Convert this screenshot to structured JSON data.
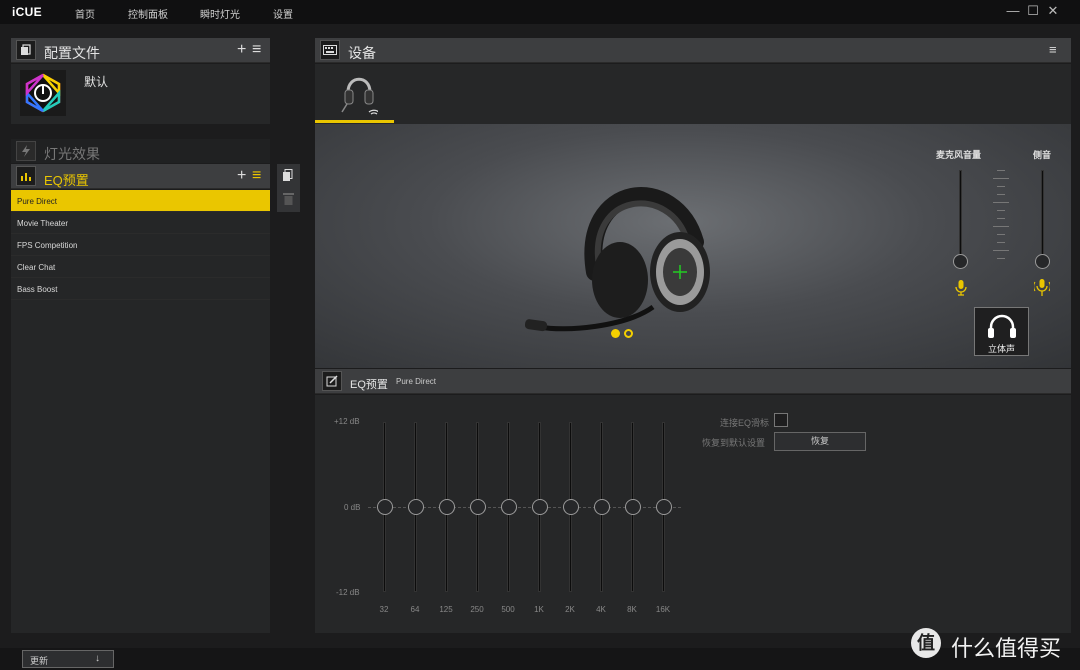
{
  "app": {
    "logo": "iCUE"
  },
  "nav": [
    "首页",
    "控制面板",
    "瞬时灯光",
    "设置"
  ],
  "window_controls": {
    "minimize": "—",
    "maximize": "☐",
    "close": "✕"
  },
  "profiles": {
    "title": "配置文件",
    "add": "+",
    "menu": "≡",
    "items": [
      {
        "name": "默认"
      }
    ]
  },
  "lighting": {
    "title": "灯光效果"
  },
  "eq_presets": {
    "title": "EQ预置",
    "add": "+",
    "menu": "≡",
    "items": [
      "Pure Direct",
      "Movie Theater",
      "FPS Competition",
      "Clear Chat",
      "Bass Boost"
    ],
    "selected": "Pure Direct"
  },
  "devices": {
    "title": "设备",
    "menu": "≡"
  },
  "mixer": {
    "mic_volume_label": "麦克风音量",
    "sidetone_label": "侧音",
    "stereo_button": "立体声",
    "mic_level": 0.0,
    "sidetone_level": 0.0
  },
  "eq": {
    "title": "EQ预置",
    "preset_name": "Pure Direct",
    "db_labels": {
      "top": "+12 dB",
      "mid": "0 dB",
      "bottom": "-12 dB"
    },
    "bands": [
      "32",
      "64",
      "125",
      "250",
      "500",
      "1K",
      "2K",
      "4K",
      "8K",
      "16K"
    ],
    "gains_db": [
      0,
      0,
      0,
      0,
      0,
      0,
      0,
      0,
      0,
      0
    ],
    "link_label": "连接EQ滑标",
    "reset_label": "恢复到默认设置",
    "reset_button": "恢复"
  },
  "footer": {
    "update_label": "更新",
    "download_icon": "↓",
    "watermark_brand": "值",
    "watermark_text": "什么值得买"
  },
  "colors": {
    "accent": "#eac600",
    "panel_header": "#3d3e40",
    "background": "#1c1c1d"
  }
}
